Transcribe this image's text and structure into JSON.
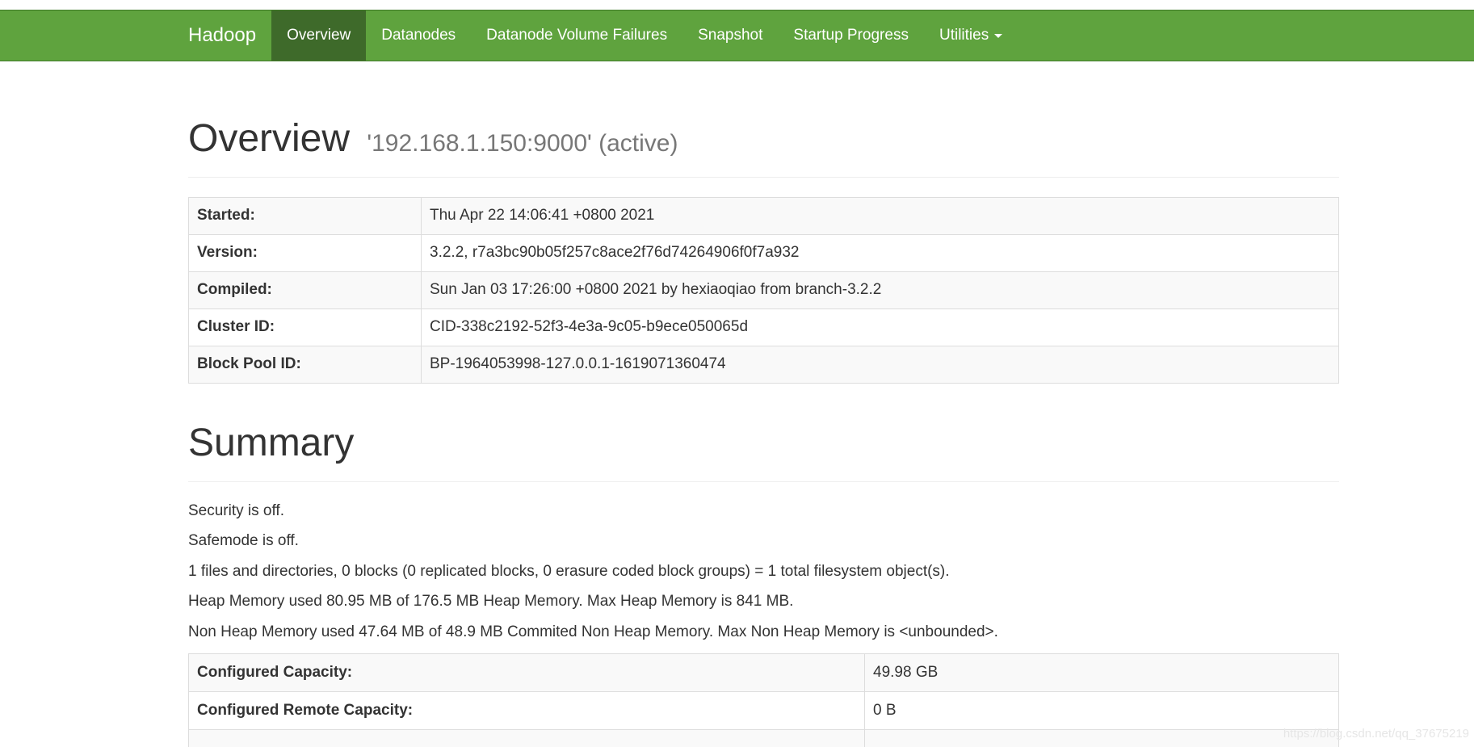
{
  "navbar": {
    "brand": "Hadoop",
    "items": [
      {
        "label": "Overview",
        "active": true
      },
      {
        "label": "Datanodes"
      },
      {
        "label": "Datanode Volume Failures"
      },
      {
        "label": "Snapshot"
      },
      {
        "label": "Startup Progress"
      },
      {
        "label": "Utilities"
      }
    ],
    "color": "#5fa33e",
    "active_color": "#3e6a2a"
  },
  "overview": {
    "title": "Overview",
    "subtitle": "'192.168.1.150:9000' (active)",
    "rows": [
      {
        "key": "Started:",
        "value": "Thu Apr 22 14:06:41 +0800 2021"
      },
      {
        "key": "Version:",
        "value": "3.2.2, r7a3bc90b05f257c8ace2f76d74264906f0f7a932"
      },
      {
        "key": "Compiled:",
        "value": "Sun Jan 03 17:26:00 +0800 2021 by hexiaoqiao from branch-3.2.2"
      },
      {
        "key": "Cluster ID:",
        "value": "CID-338c2192-52f3-4e3a-9c05-b9ece050065d"
      },
      {
        "key": "Block Pool ID:",
        "value": "BP-1964053998-127.0.0.1-1619071360474"
      }
    ]
  },
  "summary": {
    "title": "Summary",
    "lines": [
      "Security is off.",
      "Safemode is off.",
      "1 files and directories, 0 blocks (0 replicated blocks, 0 erasure coded block groups) = 1 total filesystem object(s).",
      "Heap Memory used 80.95 MB of 176.5 MB Heap Memory. Max Heap Memory is 841 MB.",
      "Non Heap Memory used 47.64 MB of 48.9 MB Commited Non Heap Memory. Max Non Heap Memory is <unbounded>."
    ],
    "capacity_rows": [
      {
        "key": "Configured Capacity:",
        "value": "49.98 GB"
      },
      {
        "key": "Configured Remote Capacity:",
        "value": "0 B"
      },
      {
        "key": "",
        "value": ""
      }
    ]
  },
  "watermark": "https://blog.csdn.net/qq_37675219"
}
